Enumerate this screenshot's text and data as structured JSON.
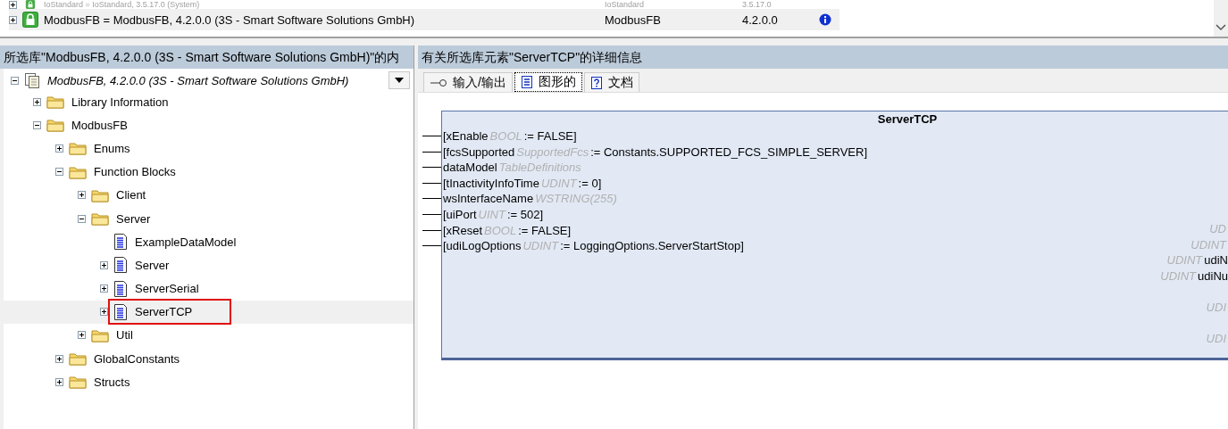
{
  "library_list": {
    "rows": [
      {
        "name": "IoStandard = IoStandard, 3.5.17.0 (System)",
        "namespace": "IoStandard",
        "version": "3.5.17.0",
        "expanded": false,
        "selected": false,
        "greyed": true,
        "info": false
      },
      {
        "name": "ModbusFB = ModbusFB, 4.2.0.0 (3S - Smart Software Solutions GmbH)",
        "namespace": "ModbusFB",
        "version": "4.2.0.0",
        "expanded": false,
        "selected": true,
        "greyed": false,
        "info": true
      }
    ]
  },
  "contents_panel": {
    "header": "所选库\"ModbusFB, 4.2.0.0 (3S - Smart Software Solutions GmbH)\"的内",
    "root": {
      "label": "ModbusFB, 4.2.0.0 (3S - Smart Software Solutions GmbH)",
      "expanded": true,
      "children": [
        {
          "label": "Library Information",
          "kind": "folder",
          "expanded": false,
          "selected": false
        },
        {
          "label": "ModbusFB",
          "kind": "folder",
          "expanded": true,
          "selected": false,
          "children": [
            {
              "label": "Enums",
              "kind": "folder",
              "expanded": false,
              "selected": false
            },
            {
              "label": "Function Blocks",
              "kind": "folder",
              "expanded": true,
              "selected": false,
              "children": [
                {
                  "label": "Client",
                  "kind": "folder",
                  "expanded": false,
                  "selected": false
                },
                {
                  "label": "Server",
                  "kind": "folder",
                  "expanded": true,
                  "selected": false,
                  "children": [
                    {
                      "label": "ExampleDataModel",
                      "kind": "pou",
                      "selected": false
                    },
                    {
                      "label": "Server",
                      "kind": "pou",
                      "expanded": false,
                      "selected": false
                    },
                    {
                      "label": "ServerSerial",
                      "kind": "pou",
                      "expanded": false,
                      "selected": false
                    },
                    {
                      "label": "ServerTCP",
                      "kind": "pou",
                      "expanded": false,
                      "selected": true
                    }
                  ]
                },
                {
                  "label": "Util",
                  "kind": "folder",
                  "expanded": false,
                  "selected": false
                }
              ]
            },
            {
              "label": "GlobalConstants",
              "kind": "folder",
              "expanded": false,
              "selected": false
            },
            {
              "label": "Structs",
              "kind": "folder",
              "expanded": false,
              "selected": false
            }
          ]
        }
      ]
    }
  },
  "details_panel": {
    "header": "有关所选库元素\"ServerTCP\"的详细信息",
    "tabs": [
      {
        "label": "输入/输出",
        "kind": "io",
        "selected": false
      },
      {
        "label": "图形的",
        "kind": "graphic",
        "selected": true
      },
      {
        "label": "文档",
        "kind": "doc",
        "selected": false
      }
    ],
    "block": {
      "title": "ServerTCP",
      "inputs": [
        {
          "name": "[xEnable",
          "type": "BOOL",
          "default": ":= FALSE]"
        },
        {
          "name": "[fcsSupported",
          "type": "SupportedFcs",
          "default": ":= Constants.SUPPORTED_FCS_SIMPLE_SERVER]"
        },
        {
          "name": "dataModel",
          "type": "TableDefinitions"
        },
        {
          "name": "[tInactivityInfoTime",
          "type": "UDINT",
          "default": ":= 0]"
        },
        {
          "name": "wsInterfaceName",
          "type": "WSTRING(255)"
        },
        {
          "name": "[uiPort",
          "type": "UINT",
          "default": ":= 502]"
        },
        {
          "name": "[xReset",
          "type": "BOOL",
          "default": ":= FALSE]"
        },
        {
          "name": "[udiLogOptions",
          "type": "UDINT",
          "default": ":= LoggingOptions.ServerStartStop]"
        }
      ],
      "outputs": [
        {
          "type": "UD"
        },
        {
          "type": "UDINT"
        },
        {
          "type": "UDINT",
          "name": "udiN"
        },
        {
          "type": "UDINT",
          "name": "udiNu"
        },
        {
          "type": "UDI"
        },
        {
          "type": "UDI"
        }
      ]
    }
  }
}
